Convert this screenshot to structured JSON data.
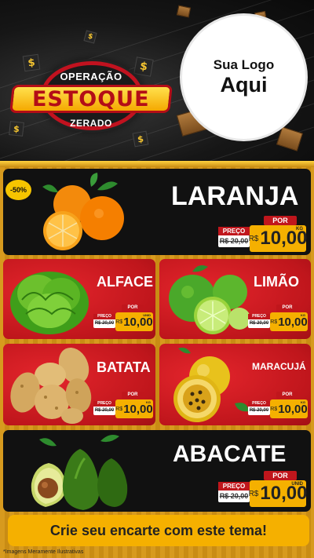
{
  "header": {
    "badge_top": "OPERAÇÃO",
    "badge_main": "ESTOQUE",
    "badge_bottom": "ZERADO",
    "logo_line1": "Sua Logo",
    "logo_line2": "Aqui",
    "dollar_glyph": "$"
  },
  "products": [
    {
      "name": "LARANJA",
      "discount_tag": "-50%",
      "price_label": "PREÇO",
      "old_price": "R$ 20,00",
      "offer_label": "POR",
      "currency": "R$",
      "price": "10,00",
      "unit": "KG"
    },
    {
      "name": "ALFACE",
      "price_label": "PREÇO",
      "old_price": "R$ 20,00",
      "offer_label": "POR",
      "currency": "R$",
      "price": "10,00",
      "unit": "UNID"
    },
    {
      "name": "LIMÃO",
      "price_label": "PREÇO",
      "old_price": "R$ 20,00",
      "offer_label": "POR",
      "currency": "R$",
      "price": "10,00",
      "unit": "KG"
    },
    {
      "name": "BATATA",
      "price_label": "PREÇO",
      "old_price": "R$ 20,00",
      "offer_label": "POR",
      "currency": "R$",
      "price": "10,00",
      "unit": "KG"
    },
    {
      "name": "MARACUJÁ",
      "price_label": "PREÇO",
      "old_price": "R$ 20,00",
      "offer_label": "POR",
      "currency": "R$",
      "price": "10,00",
      "unit": "KG"
    },
    {
      "name": "ABACATE",
      "price_label": "PREÇO",
      "old_price": "R$ 20,00",
      "offer_label": "POR",
      "currency": "R$",
      "price": "10,00",
      "unit": "UNID"
    }
  ],
  "cta": "Crie seu encarte com este tema!",
  "footnote": "*Imagens Meramente Ilustrativas",
  "colors": {
    "red": "#c0161c",
    "yellow": "#f5b000",
    "gold": "#d79a1e",
    "black": "#111111"
  }
}
